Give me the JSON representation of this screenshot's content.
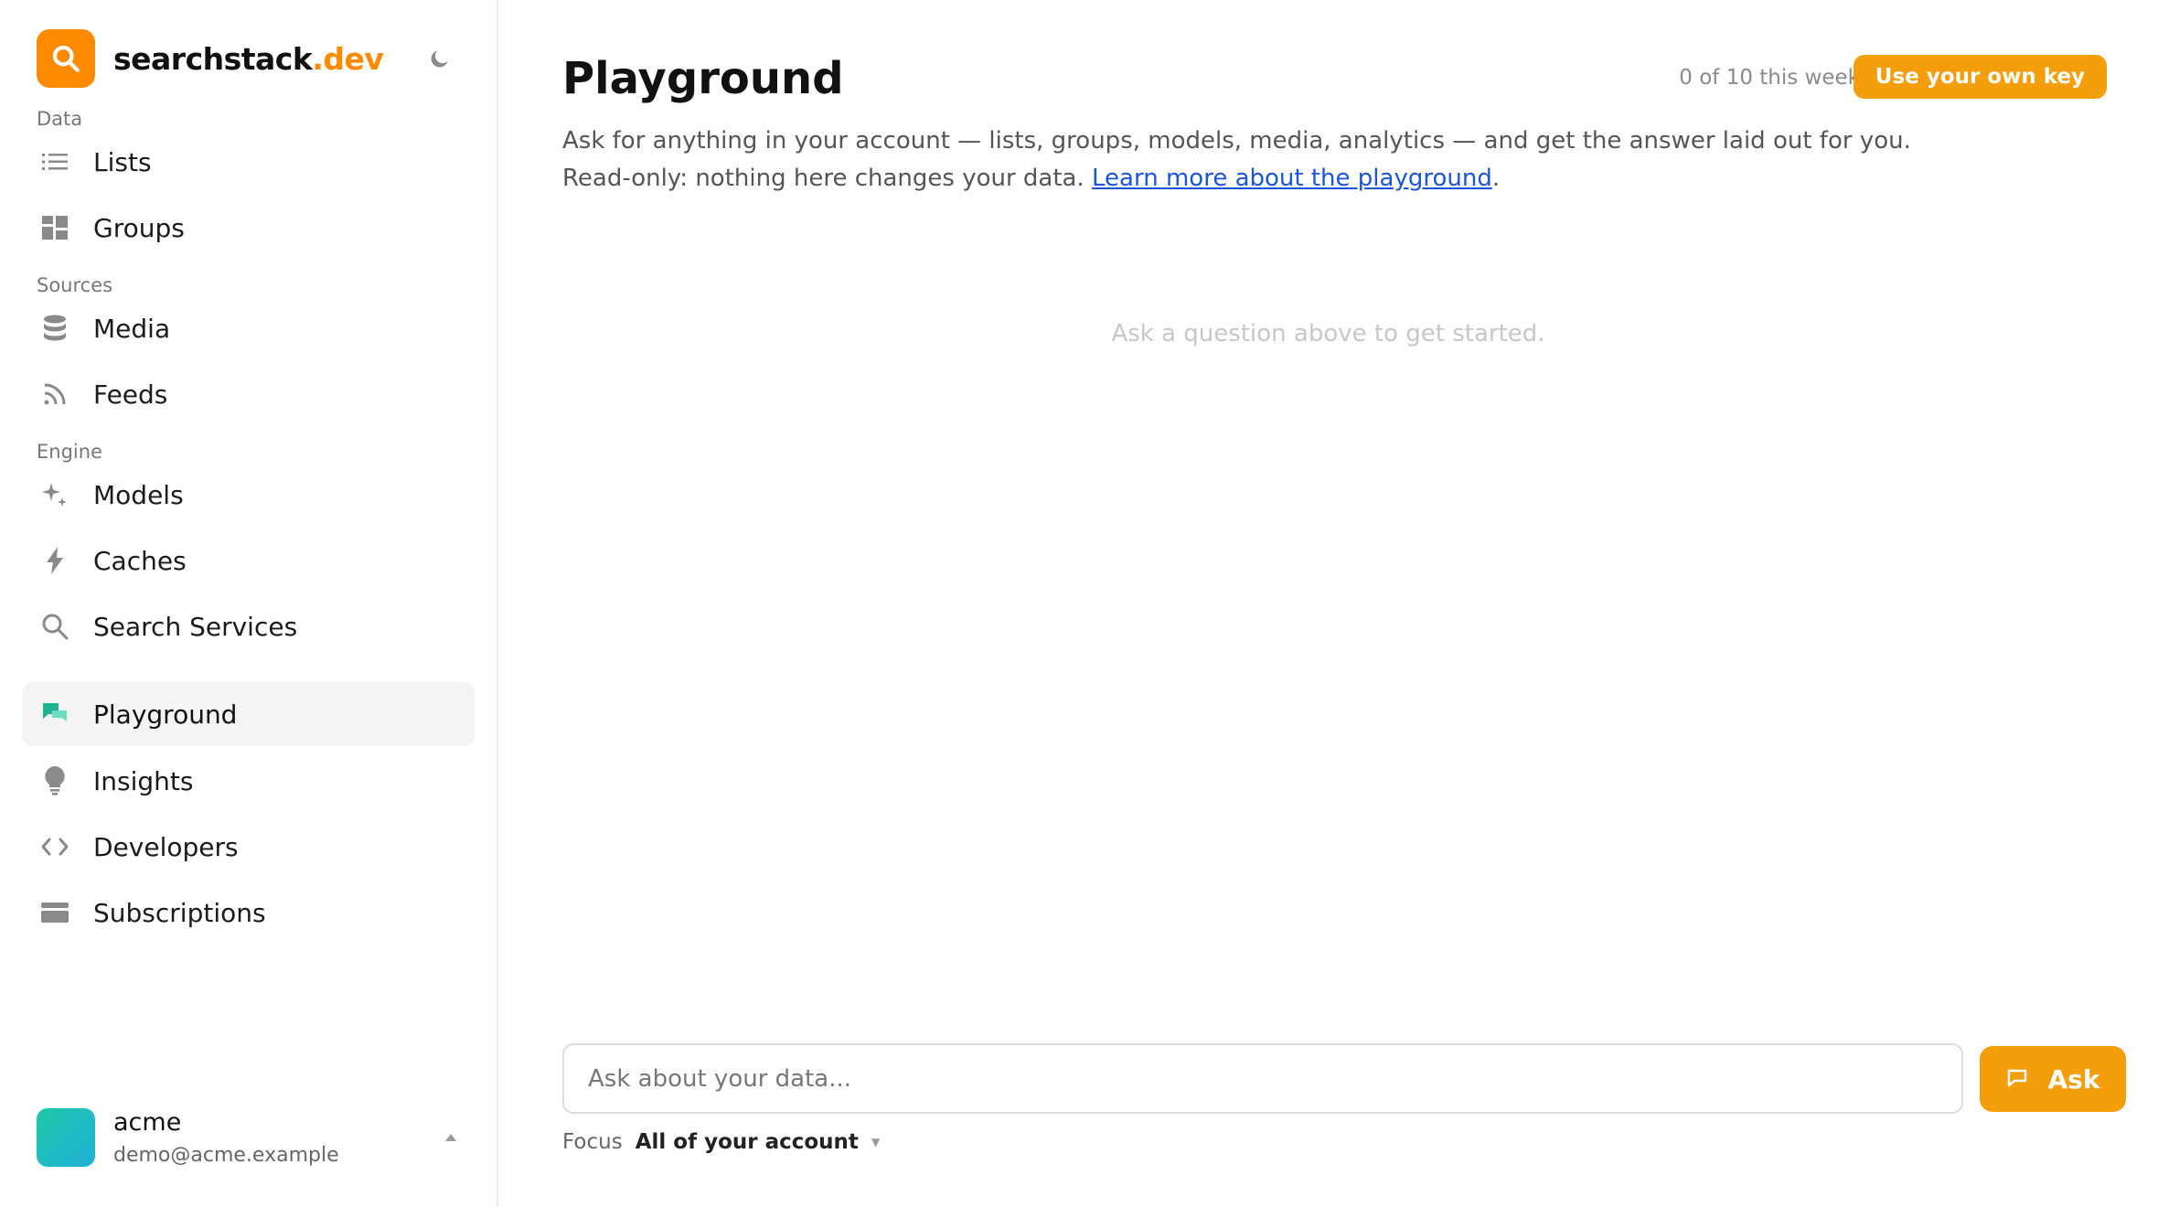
{
  "brand": {
    "name_main": "searchstack",
    "name_accent": ".dev",
    "accent_color": "#ff8a00"
  },
  "sidebar": {
    "sections": [
      {
        "label": "Data",
        "items": [
          {
            "label": "Lists",
            "icon": "list-icon"
          },
          {
            "label": "Groups",
            "icon": "grid-icon"
          }
        ]
      },
      {
        "label": "Sources",
        "items": [
          {
            "label": "Media",
            "icon": "database-icon"
          },
          {
            "label": "Feeds",
            "icon": "rss-icon"
          }
        ]
      },
      {
        "label": "Engine",
        "items": [
          {
            "label": "Models",
            "icon": "sparkle-icon"
          },
          {
            "label": "Caches",
            "icon": "bolt-icon"
          },
          {
            "label": "Search Services",
            "icon": "search-icon"
          }
        ]
      },
      {
        "label": "",
        "items": [
          {
            "label": "Playground",
            "icon": "chat-bubbles-icon",
            "active": true
          },
          {
            "label": "Insights",
            "icon": "lightbulb-icon"
          },
          {
            "label": "Developers",
            "icon": "code-icon"
          },
          {
            "label": "Subscriptions",
            "icon": "card-icon"
          }
        ]
      }
    ]
  },
  "user": {
    "name": "acme",
    "email": "demo@acme.example"
  },
  "main": {
    "title": "Playground",
    "usage": "0 of 10 this week",
    "own_key_label": "Use your own key",
    "description_line1": "Ask for anything in your account — lists, groups, models, media, analytics — and get the answer laid out for you.",
    "description_line2_prefix": "Read-only: nothing here changes your data. ",
    "description_link": "Learn more about the playground",
    "description_line2_suffix": ".",
    "empty_state": "Ask a question above to get started.",
    "ask_placeholder": "Ask about your data...",
    "ask_button_label": "Ask",
    "focus_label": "Focus",
    "focus_value": "All of your account"
  },
  "colors": {
    "primary_button": "#f59e0b",
    "active_nav_bg": "#f4f4f4",
    "link": "#1a56db"
  }
}
